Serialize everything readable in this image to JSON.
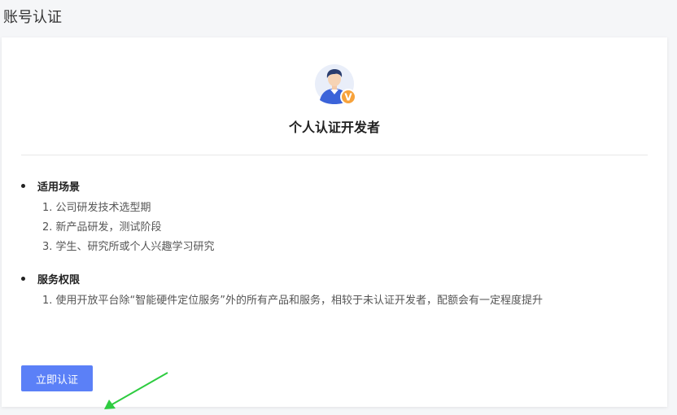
{
  "header": {
    "title": "账号认证"
  },
  "card": {
    "role_title": "个人认证开发者",
    "verified_badge": "V",
    "sections": [
      {
        "title": "适用场景",
        "items": [
          "1. 公司研发技术选型期",
          "2. 新产品研发，测试阶段",
          "3. 学生、研究所或个人兴趣学习研究"
        ]
      },
      {
        "title": "服务权限",
        "items": [
          "1. 使用开放平台除“智能硬件定位服务”外的所有产品和服务，相较于未认证开发者，配额会有一定程度提升"
        ]
      }
    ],
    "button_label": "立即认证"
  },
  "colors": {
    "primary": "#5b80f7",
    "badge": "#f7a23b",
    "arrow": "#2ecc40"
  },
  "icons": {
    "avatar": "developer-avatar-icon",
    "arrow": "green-arrow-annotation"
  }
}
